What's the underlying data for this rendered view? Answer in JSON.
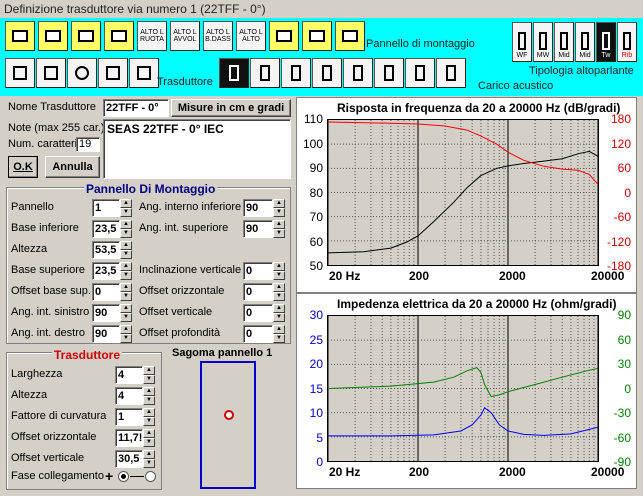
{
  "window": {
    "title": "Definizione trasduttore via numero 1 (22TFF - 0°)"
  },
  "toolbar": {
    "panel_label": "Pannello di montaggio",
    "transducer_label": "Trasduttore",
    "acoustic_load_label": "Carico acustico",
    "speaker_type_label": "Tipologia altoparlante",
    "panel_buttons": [
      "",
      "",
      "",
      "",
      "ALTO\nL\nRUOTA",
      "ALTO\nL\nAVVOL",
      "ALTO\nL\nB.DASS",
      "ALTO\nL\nALTO",
      "",
      "",
      ""
    ],
    "speaker_types": [
      "WF",
      "MW",
      "Mid",
      "Mid",
      "Tw",
      "Rib"
    ]
  },
  "form": {
    "name_label": "Nome Trasduttore",
    "name_value": "22TFF - 0°",
    "units_label": "Misure in cm e gradi",
    "note_label": "Note (max 255 car.)",
    "note_value": "SEAS 22TFF - 0° IEC",
    "chars_label": "Num. caratteri",
    "chars_value": "19",
    "ok_label": "O.K",
    "cancel_label": "Annulla"
  },
  "mount_panel": {
    "title": "Pannello Di Montaggio",
    "left": [
      {
        "label": "Pannello",
        "value": "1"
      },
      {
        "label": "Base inferiore",
        "value": "23,5"
      },
      {
        "label": "Altezza",
        "value": "53,5"
      },
      {
        "label": "Base superiore",
        "value": "23,5"
      },
      {
        "label": "Offset base sup.",
        "value": "0"
      },
      {
        "label": "Ang. int. sinistro",
        "value": "90"
      },
      {
        "label": "Ang. int. destro",
        "value": "90"
      }
    ],
    "right": [
      {
        "label": "Ang. interno inferiore",
        "value": "90"
      },
      {
        "label": "Ang. int. superiore",
        "value": "90"
      },
      {
        "label": "Inclinazione verticale",
        "value": "0"
      },
      {
        "label": "Offset orizzontale",
        "value": "0"
      },
      {
        "label": "Offset verticale",
        "value": "0"
      },
      {
        "label": "Offset profondità",
        "value": "0"
      }
    ]
  },
  "transducer": {
    "title": "Trasduttore",
    "fields": [
      {
        "label": "Larghezza",
        "value": "4"
      },
      {
        "label": "Altezza",
        "value": "4"
      },
      {
        "label": "Fattore di curvatura",
        "value": "1"
      },
      {
        "label": "Offset orizzontale",
        "value": "11,7!"
      },
      {
        "label": "Offset verticale",
        "value": "30,5"
      }
    ],
    "phase_label": "Fase collegamento",
    "phase_plus": "+",
    "phase_minus": "−"
  },
  "shape": {
    "title": "Sagoma pannello 1"
  },
  "chart_data": [
    {
      "type": "line",
      "title": "Risposta in frequenza da 20 a 20000 Hz (dB/gradi)",
      "x_ticks": [
        "20 Hz",
        "200",
        "2000",
        "20000"
      ],
      "y_left_ticks": [
        "110",
        "100",
        "90",
        "80",
        "70",
        "60",
        "50"
      ],
      "y_right_ticks": [
        "180",
        "120",
        "60",
        "0",
        "-60",
        "-120",
        "-180"
      ],
      "ylim_left": [
        50,
        110
      ],
      "ylim_right": [
        -180,
        180
      ],
      "series": [
        {
          "color": "#000000",
          "axis": "left",
          "x": [
            20,
            50,
            100,
            150,
            200,
            300,
            500,
            700,
            1000,
            1500,
            2000,
            3000,
            5000,
            8000,
            12000,
            16000,
            20000
          ],
          "y": [
            55,
            55.5,
            57,
            59.5,
            62,
            68,
            76,
            82,
            87,
            90,
            91,
            92,
            93,
            94,
            96,
            97,
            95
          ]
        },
        {
          "color": "#ff0000",
          "axis": "right",
          "x": [
            20,
            50,
            100,
            200,
            400,
            700,
            1000,
            1500,
            2000,
            3000,
            5000,
            8000,
            12000,
            16000,
            20000
          ],
          "y": [
            175,
            173,
            172,
            170,
            165,
            155,
            140,
            120,
            100,
            80,
            65,
            58,
            55,
            45,
            20
          ]
        }
      ]
    },
    {
      "type": "line",
      "title": "Impedenza elettrica da 20 a 20000 Hz (ohm/gradi)",
      "x_ticks": [
        "20 Hz",
        "200",
        "2000",
        "20000"
      ],
      "y_left_ticks": [
        "30",
        "25",
        "20",
        "15",
        "10",
        "5",
        "0"
      ],
      "y_right_ticks": [
        "90",
        "60",
        "30",
        "0",
        "-30",
        "-60",
        "-90"
      ],
      "ylim_left": [
        0,
        30
      ],
      "ylim_right": [
        -90,
        90
      ],
      "series": [
        {
          "color": "#0000ff",
          "axis": "left",
          "x": [
            20,
            100,
            300,
            600,
            800,
            1000,
            1100,
            1300,
            1600,
            2000,
            3000,
            5000,
            10000,
            20000
          ],
          "y": [
            5.2,
            5.2,
            5.4,
            6.2,
            7.5,
            9.5,
            11,
            10,
            7.5,
            6.2,
            5.5,
            5.3,
            5.6,
            7
          ]
        },
        {
          "color": "#008000",
          "axis": "right",
          "x": [
            20,
            100,
            300,
            500,
            700,
            900,
            1000,
            1100,
            1300,
            1600,
            2000,
            4000,
            8000,
            15000,
            20000
          ],
          "y": [
            0,
            3,
            8,
            14,
            22,
            26,
            20,
            5,
            -10,
            -8,
            -4,
            5,
            14,
            22,
            25
          ]
        }
      ]
    }
  ]
}
